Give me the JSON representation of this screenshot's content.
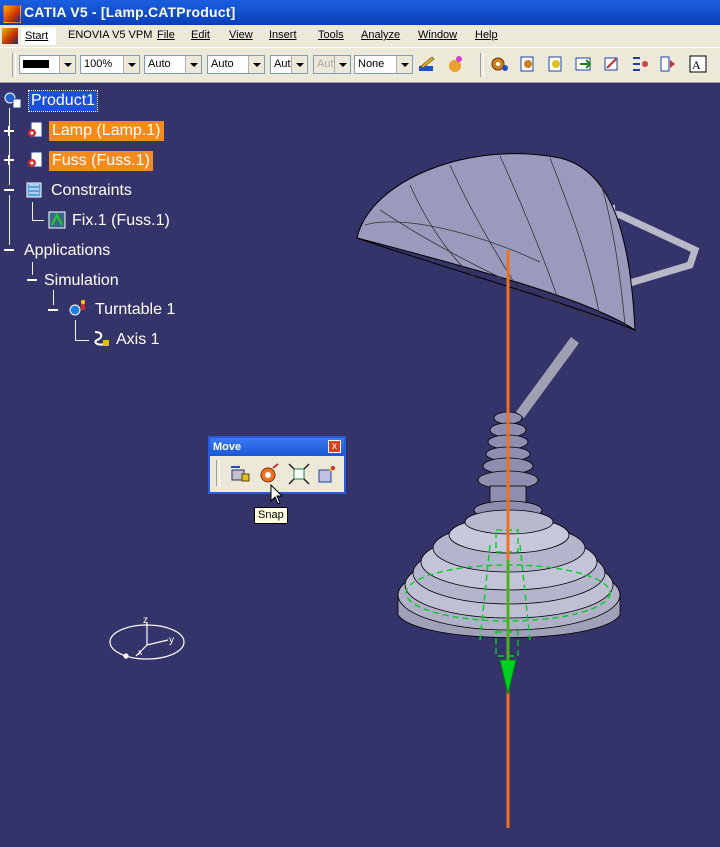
{
  "window": {
    "title": "CATIA V5 - [Lamp.CATProduct]"
  },
  "menu": {
    "items": [
      {
        "label": "Start"
      },
      {
        "label": "ENOVIA V5 VPM"
      },
      {
        "label": "File"
      },
      {
        "label": "Edit"
      },
      {
        "label": "View"
      },
      {
        "label": "Insert"
      },
      {
        "label": "Tools"
      },
      {
        "label": "Analyze"
      },
      {
        "label": "Window"
      },
      {
        "label": "Help"
      }
    ]
  },
  "toolbar": {
    "zoom": "100%",
    "combo_auto1": "Auto",
    "combo_auto2": "Auto",
    "combo_aut": "Aut",
    "combo_aut_disabled": "Aut",
    "combo_none": "None",
    "color_swatch": "#000000"
  },
  "tree": {
    "root": "Product1",
    "lamp": "Lamp (Lamp.1)",
    "fuss": "Fuss (Fuss.1)",
    "constraints": "Constraints",
    "fix": "Fix.1 (Fuss.1)",
    "applications": "Applications",
    "simulation": "Simulation",
    "turntable": "Turntable 1",
    "axis": "Axis 1"
  },
  "move_toolbar": {
    "title": "Move",
    "close": "x"
  },
  "tooltip": {
    "text": "Snap"
  },
  "compass": {
    "z": "z",
    "y": "y",
    "x": "x"
  },
  "colors": {
    "background": "#34346a",
    "highlight": "#f58a1e",
    "axis": "#f07020",
    "snap": "#00d020"
  }
}
